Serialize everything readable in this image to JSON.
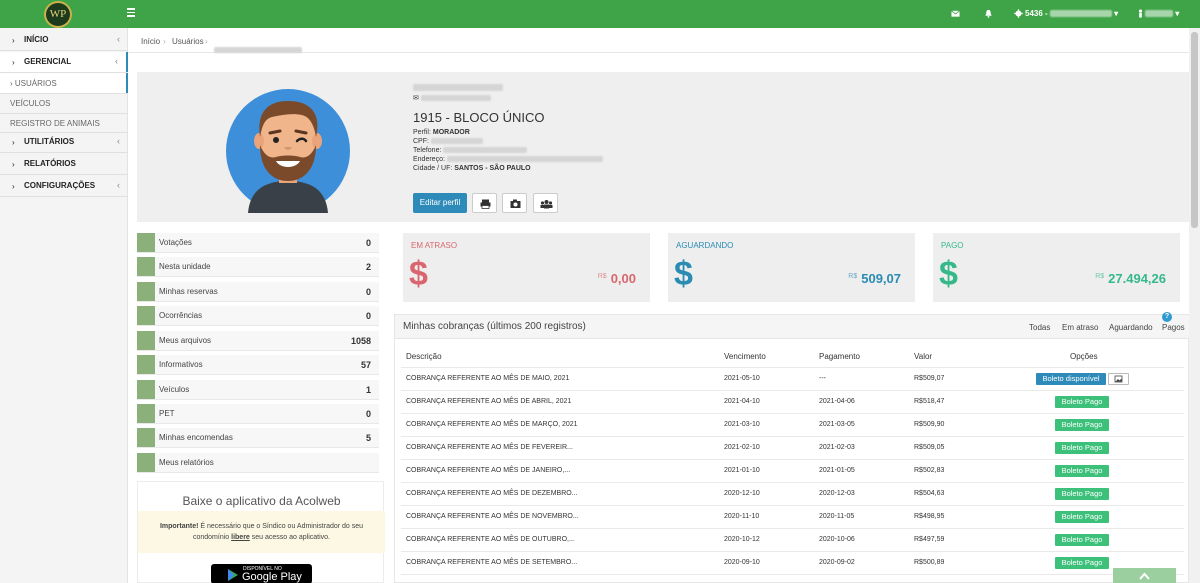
{
  "header": {
    "logo_text": "WP",
    "account_code": "5436 -",
    "colors": {
      "primary": "#3fa447"
    }
  },
  "sidebar": {
    "items": [
      {
        "label": "INÍCIO"
      },
      {
        "label": "GERENCIAL"
      },
      {
        "label": "USUÁRIOS"
      },
      {
        "label": "VEÍCULOS"
      },
      {
        "label": "REGISTRO DE ANIMAIS"
      },
      {
        "label": "UTILITÁRIOS"
      },
      {
        "label": "RELATÓRIOS"
      },
      {
        "label": "CONFIGURAÇÕES"
      }
    ]
  },
  "breadcrumb": {
    "home": "Início",
    "section": "Usuários"
  },
  "profile": {
    "unit": "1915 - BLOCO ÚNICO",
    "profile_label": "Perfil:",
    "profile_value": "MORADOR",
    "cpf_label": "CPF:",
    "phone_label": "Telefone:",
    "address_label": "Endereço:",
    "city_label": "Cidade / UF:",
    "city_value": "SANTOS - SÃO PAULO",
    "edit_button": "Editar perfil"
  },
  "stats": [
    {
      "label": "Votações",
      "value": "0"
    },
    {
      "label": "Nesta unidade",
      "value": "2"
    },
    {
      "label": "Minhas reservas",
      "value": "0"
    },
    {
      "label": "Ocorrências",
      "value": "0"
    },
    {
      "label": "Meus arquivos",
      "value": "1058"
    },
    {
      "label": "Informativos",
      "value": "57"
    },
    {
      "label": "Veículos",
      "value": "1"
    },
    {
      "label": "PET",
      "value": "0"
    },
    {
      "label": "Minhas encomendas",
      "value": "5"
    },
    {
      "label": "Meus relatórios",
      "value": ""
    }
  ],
  "app": {
    "title": "Baixe o aplicativo da Acolweb",
    "note_bold": "Importante!",
    "note_1": "É necessário que o Síndico ou Administrador do seu condomínio",
    "note_link": "libere",
    "note_2": "seu acesso ao aplicativo.",
    "store_small": "DISPONÍVEL NO",
    "store_big": "Google Play"
  },
  "cards": [
    {
      "title": "EM ATRASO",
      "currency": "R$",
      "amount": "0,00",
      "color": "#d9666f"
    },
    {
      "title": "AGUARDANDO",
      "currency": "R$",
      "amount": "509,07",
      "color": "#2a8bb3"
    },
    {
      "title": "PAGO",
      "currency": "R$",
      "amount": "27.494,26",
      "color": "#35b98a"
    }
  ],
  "charges": {
    "title": "Minhas cobranças (últimos 200 registros)",
    "filters": [
      "Todas",
      "Em atraso",
      "Aguardando",
      "Pagos"
    ],
    "help": "?",
    "columns": [
      "Descrição",
      "Vencimento",
      "Pagamento",
      "Valor",
      "Opções"
    ],
    "rows": [
      {
        "desc": "COBRANÇA REFERENTE AO MÊS DE MAIO, 2021",
        "due": "2021-05-10",
        "paid": "---",
        "value": "R$509,07",
        "status": "Boleto disponível"
      },
      {
        "desc": "COBRANÇA REFERENTE AO MÊS DE ABRIL, 2021",
        "due": "2021-04-10",
        "paid": "2021-04-06",
        "value": "R$518,47",
        "status": "Boleto Pago"
      },
      {
        "desc": "COBRANÇA REFERENTE AO MÊS DE MARÇO, 2021",
        "due": "2021-03-10",
        "paid": "2021-03-05",
        "value": "R$509,90",
        "status": "Boleto Pago"
      },
      {
        "desc": "COBRANÇA REFERENTE AO MÊS DE FEVEREIR...",
        "due": "2021-02-10",
        "paid": "2021-02-03",
        "value": "R$509,05",
        "status": "Boleto Pago"
      },
      {
        "desc": "COBRANÇA REFERENTE AO MÊS DE JANEIRO,...",
        "due": "2021-01-10",
        "paid": "2021-01-05",
        "value": "R$502,83",
        "status": "Boleto Pago"
      },
      {
        "desc": "COBRANÇA REFERENTE AO MÊS DE DEZEMBRO...",
        "due": "2020-12-10",
        "paid": "2020-12-03",
        "value": "R$504,63",
        "status": "Boleto Pago"
      },
      {
        "desc": "COBRANÇA REFERENTE AO MÊS DE NOVEMBRO...",
        "due": "2020-11-10",
        "paid": "2020-11-05",
        "value": "R$498,95",
        "status": "Boleto Pago"
      },
      {
        "desc": "COBRANÇA REFERENTE AO MÊS DE OUTUBRO,...",
        "due": "2020-10-12",
        "paid": "2020-10-06",
        "value": "R$497,59",
        "status": "Boleto Pago"
      },
      {
        "desc": "COBRANÇA REFERENTE AO MÊS DE SETEMBRO...",
        "due": "2020-09-10",
        "paid": "2020-09-02",
        "value": "R$500,89",
        "status": "Boleto Pago"
      }
    ]
  }
}
